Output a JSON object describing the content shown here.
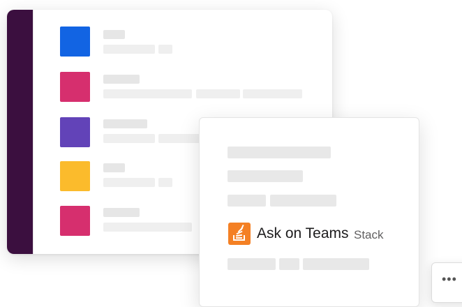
{
  "colors": {
    "sidebar": "#3b0f3f",
    "channel_swatches": [
      "#1264e3",
      "#d62f6e",
      "#6243b8",
      "#fbbb2c",
      "#d62f6e"
    ],
    "app_logo": "#f48024"
  },
  "channel_list": {
    "items": [
      {
        "swatch": "blue"
      },
      {
        "swatch": "pink"
      },
      {
        "swatch": "purple"
      },
      {
        "swatch": "yellow"
      },
      {
        "swatch": "pink"
      }
    ]
  },
  "app_card": {
    "logo_icon": "stack-overflow-icon",
    "title": "Ask on Teams",
    "subtitle": "Stack"
  },
  "more_button": {
    "icon": "more-horizontal-icon",
    "label": "•••"
  }
}
